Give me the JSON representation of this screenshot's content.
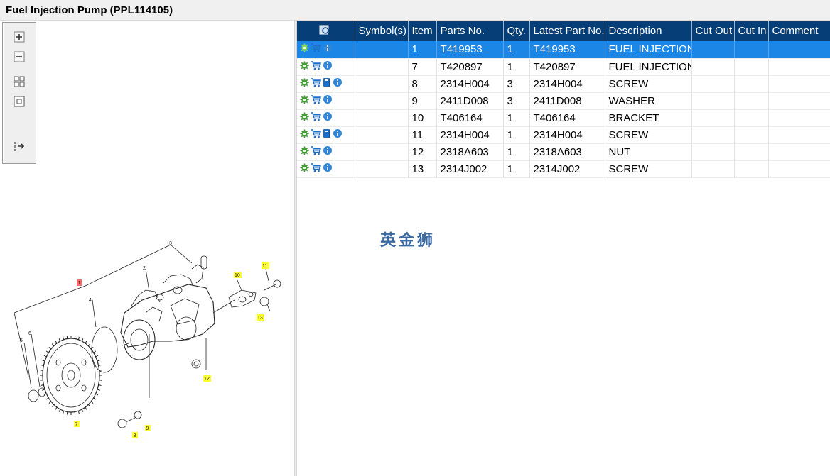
{
  "window": {
    "title": "Fuel Injection Pump (PPL114105)"
  },
  "toolbar": {
    "buttons": [
      "zoom-in-icon",
      "zoom-out-icon",
      "fit-view-icon",
      "actual-size-icon",
      "export-icon"
    ]
  },
  "diagram": {
    "callouts": [
      "1",
      "2",
      "3",
      "4",
      "5",
      "6",
      "7",
      "8",
      "9",
      "10",
      "11",
      "12",
      "13"
    ],
    "highlight_color": "#ffff33",
    "selected_callout_color": "#ff6b6b"
  },
  "table": {
    "headers": {
      "symbol_icon": "zoom-parts-icon",
      "symbols": "Symbol(s)",
      "item": "Item",
      "parts_no": "Parts No.",
      "qty": "Qty.",
      "latest_part_no": "Latest Part No.",
      "description": "Description",
      "cut_out": "Cut Out",
      "cut_in": "Cut In",
      "comment": "Comment"
    },
    "rows": [
      {
        "icons": [
          "settings-icon",
          "cart-icon",
          "info-icon"
        ],
        "symbols": "",
        "item": "1",
        "parts_no": "T419953",
        "qty": "1",
        "latest_part_no": "T419953",
        "description": "FUEL INJECTION PU",
        "cut_out": "",
        "cut_in": "",
        "comment": ""
      },
      {
        "icons": [
          "settings-icon",
          "cart-icon",
          "info-icon"
        ],
        "symbols": "",
        "item": "7",
        "parts_no": "T420897",
        "qty": "1",
        "latest_part_no": "T420897",
        "description": "FUEL INJECTION PU",
        "cut_out": "",
        "cut_in": "",
        "comment": ""
      },
      {
        "icons": [
          "settings-icon",
          "cart-icon",
          "book-icon",
          "info-icon"
        ],
        "symbols": "",
        "item": "8",
        "parts_no": "2314H004",
        "qty": "3",
        "latest_part_no": "2314H004",
        "description": "SCREW",
        "cut_out": "",
        "cut_in": "",
        "comment": ""
      },
      {
        "icons": [
          "settings-icon",
          "cart-icon",
          "info-icon"
        ],
        "symbols": "",
        "item": "9",
        "parts_no": "2411D008",
        "qty": "3",
        "latest_part_no": "2411D008",
        "description": "WASHER",
        "cut_out": "",
        "cut_in": "",
        "comment": ""
      },
      {
        "icons": [
          "settings-icon",
          "cart-icon",
          "info-icon"
        ],
        "symbols": "",
        "item": "10",
        "parts_no": "T406164",
        "qty": "1",
        "latest_part_no": "T406164",
        "description": "BRACKET",
        "cut_out": "",
        "cut_in": "",
        "comment": ""
      },
      {
        "icons": [
          "settings-icon",
          "cart-icon",
          "book-icon",
          "info-icon"
        ],
        "symbols": "",
        "item": "11",
        "parts_no": "2314H004",
        "qty": "1",
        "latest_part_no": "2314H004",
        "description": "SCREW",
        "cut_out": "",
        "cut_in": "",
        "comment": ""
      },
      {
        "icons": [
          "settings-icon",
          "cart-icon",
          "info-icon"
        ],
        "symbols": "",
        "item": "12",
        "parts_no": "2318A603",
        "qty": "1",
        "latest_part_no": "2318A603",
        "description": "NUT",
        "cut_out": "",
        "cut_in": "",
        "comment": ""
      },
      {
        "icons": [
          "settings-icon",
          "cart-icon",
          "info-icon"
        ],
        "symbols": "",
        "item": "13",
        "parts_no": "2314J002",
        "qty": "1",
        "latest_part_no": "2314J002",
        "description": "SCREW",
        "cut_out": "",
        "cut_in": "",
        "comment": ""
      }
    ],
    "selected_row": 0
  },
  "watermark": {
    "text": "英金狮"
  },
  "colors": {
    "header_bg": "#063f78",
    "selected_row": "#1c86e6",
    "gear_icon": "#3c9b2e",
    "cart_icon": "#1f6fc7",
    "info_icon": "#2f86d6"
  }
}
